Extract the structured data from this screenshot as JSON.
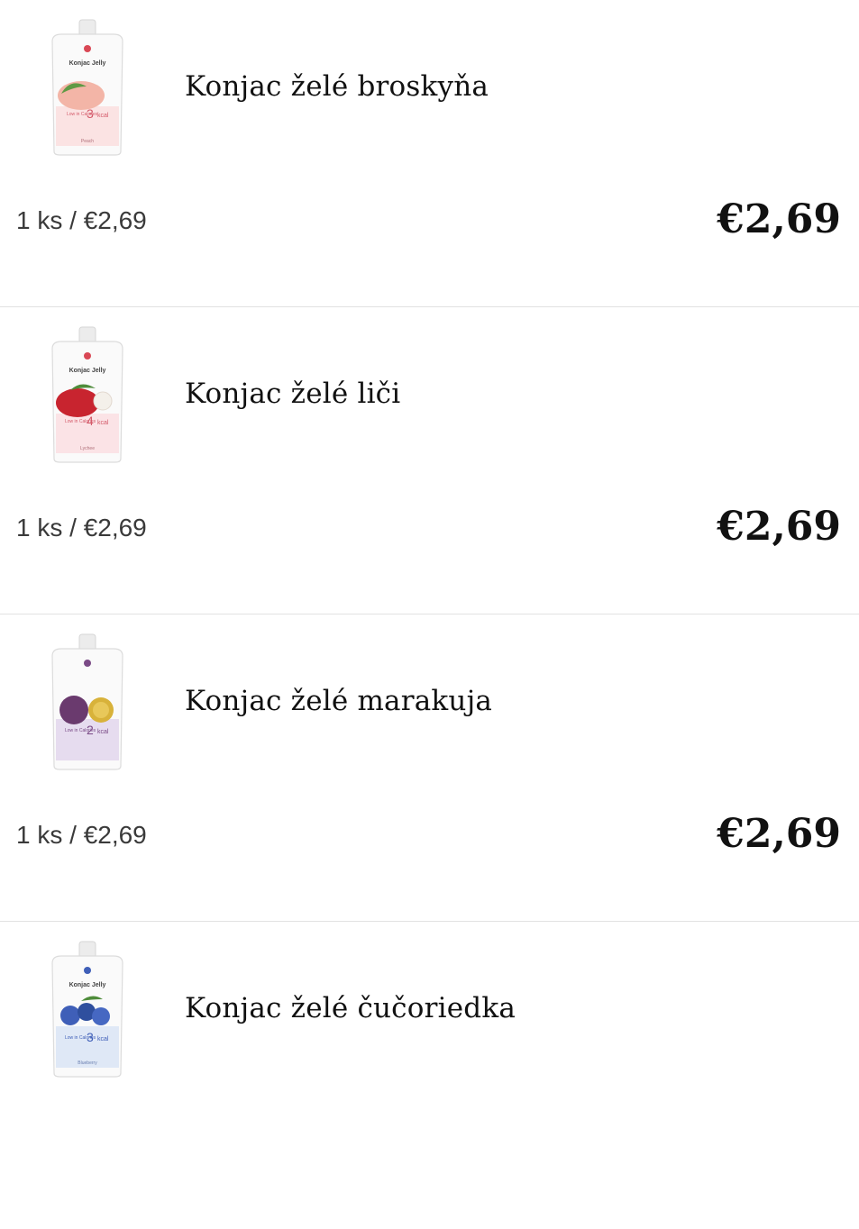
{
  "products": [
    {
      "name": "Konjac želé broskyňa",
      "unit_price": "1 ks / €2,69",
      "price": "€2,69",
      "image": {
        "icon": "peach-jelly-pouch-icon",
        "brand_text": "Konjac Jelly",
        "kcal_number": "3",
        "kcal_unit": "kcal",
        "calorie_text": "Low in Calories",
        "flavor_label": "Peach",
        "fruit_color": "#f3b5a7",
        "leaf_color": "#5f9a45",
        "band_color": "#fbe3e3"
      }
    },
    {
      "name": "Konjac želé liči",
      "unit_price": "1 ks / €2,69",
      "price": "€2,69",
      "image": {
        "icon": "lychee-jelly-pouch-icon",
        "brand_text": "Konjac Jelly",
        "kcal_number": "4",
        "kcal_unit": "kcal",
        "calorie_text": "Low in Calories",
        "flavor_label": "Lychee",
        "fruit_color": "#c8242f",
        "leaf_color": "#4e8c3a",
        "band_color": "#fbe3e6"
      }
    },
    {
      "name": "Konjac želé marakuja",
      "unit_price": "1 ks / €2,69",
      "price": "€2,69",
      "image": {
        "icon": "passion-fruit-jelly-pouch-icon",
        "brand_text": "",
        "kcal_number": "2",
        "kcal_unit": "kcal",
        "calorie_text": "Low in Calories",
        "flavor_label": "",
        "fruit_color": "#6a3a6e",
        "leaf_color": "#d8b23a",
        "band_color": "#e6dcef"
      }
    },
    {
      "name": "Konjac želé čučoriedka",
      "unit_price": "",
      "price": "",
      "image": {
        "icon": "blueberry-jelly-pouch-icon",
        "brand_text": "Konjac Jelly",
        "kcal_number": "3",
        "kcal_unit": "kcal",
        "calorie_text": "Low in Calories",
        "flavor_label": "Blueberry",
        "fruit_color": "#3f5fb8",
        "leaf_color": "#4e8c3a",
        "band_color": "#dfe8f6"
      }
    }
  ]
}
